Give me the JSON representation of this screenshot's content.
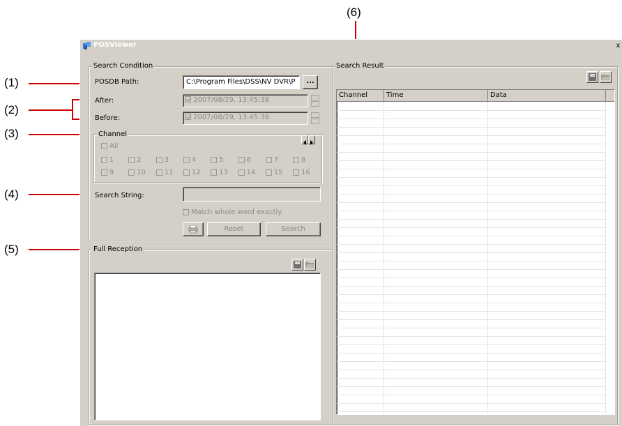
{
  "callouts": [
    "(1)",
    "(2)",
    "(3)",
    "(4)",
    "(5)",
    "(6)"
  ],
  "window": {
    "title": "POSViewer",
    "close_label": "x"
  },
  "search_condition": {
    "group_label": "Search Condition",
    "posdb_label": "POSDB Path:",
    "posdb_value": "C:\\Program Files\\DSS\\NV DVR\\P",
    "browse_label": "...",
    "after_label": "After:",
    "after_value": "2007/08/29, 13:45:38",
    "before_label": "Before:",
    "before_value": "2007/08/29, 13:45:38",
    "channel_label": "Channel",
    "all_label": "All",
    "channels_row1": [
      "1",
      "2",
      "3",
      "4",
      "5",
      "6",
      "7",
      "8"
    ],
    "channels_row2": [
      "9",
      "10",
      "11",
      "12",
      "13",
      "14",
      "15",
      "16"
    ],
    "search_string_label": "Search String:",
    "search_string_value": "",
    "match_label": "Match whole word exactly",
    "reset_label": "Reset",
    "search_label": "Search"
  },
  "full_reception": {
    "group_label": "Full Reception"
  },
  "search_result": {
    "group_label": "Search Result",
    "columns": [
      "Channel",
      "Time",
      "Data"
    ]
  },
  "colors": {
    "window_bg": "#d4d0c8",
    "callout_line": "#cc0000",
    "disabled_text": "#8c8a84"
  },
  "icons": [
    "app-icon",
    "save-icon",
    "folder-open-icon",
    "print-icon",
    "arrow-left-icon",
    "arrow-right-icon"
  ]
}
